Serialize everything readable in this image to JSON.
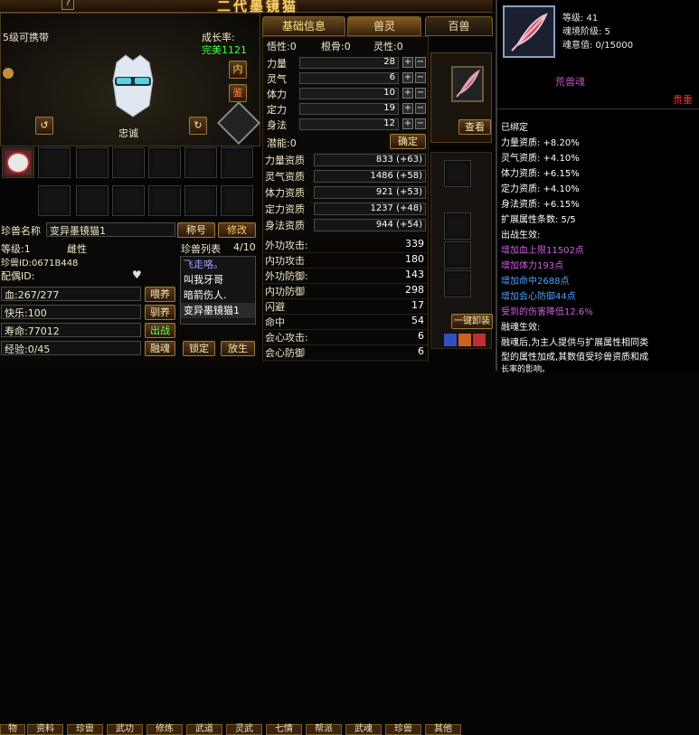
{
  "window": {
    "title": "二代墨镜猫"
  },
  "tabs": [
    {
      "label": "基础信息"
    },
    {
      "label": "兽灵"
    },
    {
      "label": "百兽"
    }
  ],
  "pet": {
    "level_carry": "5级可携带",
    "growth_label": "成长率:",
    "growth_value": "完美1121",
    "side_btn_1": "内",
    "side_btn_2": "鉴",
    "loyalty": "忠诚"
  },
  "attributes": {
    "wuxing_label": "悟性:0",
    "genggu_label": "根骨:0",
    "lingxing_label": "灵性:0",
    "stats": [
      {
        "label": "力量",
        "value": "28"
      },
      {
        "label": "灵气",
        "value": "6"
      },
      {
        "label": "体力",
        "value": "10"
      },
      {
        "label": "定力",
        "value": "19"
      },
      {
        "label": "身法",
        "value": "12"
      }
    ],
    "potential": "潜能:0",
    "confirm": "确定",
    "aptitudes": [
      {
        "label": "力量资质",
        "value": "833 (+63)"
      },
      {
        "label": "灵气资质",
        "value": "1486 (+58)"
      },
      {
        "label": "体力资质",
        "value": "921 (+53)"
      },
      {
        "label": "定力资质",
        "value": "1237 (+48)"
      },
      {
        "label": "身法资质",
        "value": "944 (+54)"
      }
    ],
    "combat": [
      {
        "label": "外功攻击:",
        "value": "339"
      },
      {
        "label": "内功攻击",
        "value": "180"
      },
      {
        "label": "外功防御:",
        "value": "143"
      },
      {
        "label": "内功防御",
        "value": "298"
      },
      {
        "label": "闪避",
        "value": "17"
      },
      {
        "label": "命中",
        "value": "54"
      },
      {
        "label": "会心攻击:",
        "value": "6"
      },
      {
        "label": "会心防御",
        "value": "6"
      }
    ]
  },
  "pet_info": {
    "name_label": "珍兽名称",
    "name_value": "变异墨镜猫1",
    "title_btn": "称号",
    "modify_btn": "修改",
    "level_label": "等级:1",
    "gender": "雌性",
    "pet_id": "珍兽ID:0671B448",
    "mate_id": "配偶ID:",
    "blood": "血:267/277",
    "happy": "快乐:100",
    "life": "寿命:77012",
    "exp": "经验:0/45",
    "feed_btn": "喂养",
    "tame_btn": "驯养",
    "battle_btn": "出战",
    "fuse_btn": "融魂",
    "lock_btn": "锁定",
    "release_btn": "放生",
    "list_label": "珍兽列表",
    "list_count": "4/10",
    "list_items": [
      "飞走咯。",
      "叫我牙哥",
      "暗箭伤人.",
      "变异墨镜猫1"
    ],
    "one_key_btn": "一键卸装",
    "view_btn": "查看"
  },
  "bottom_tabs": [
    "物",
    "资料",
    "珍兽",
    "武功",
    "修炼",
    "武道",
    "灵武",
    "七情",
    "帮派",
    "武魂",
    "珍兽",
    "其他"
  ],
  "soul_panel": {
    "level": "等级: 41",
    "realm": "魂境阶级: 5",
    "intent": "魂意值: 0/15000",
    "name": "荒兽魂",
    "quality": "贵重",
    "bound": "已绑定",
    "attrs": [
      "力量资质: +8.20%",
      "灵气资质: +4.10%",
      "体力资质: +6.15%",
      "定力资质: +4.10%",
      "身法资质: +6.15%"
    ],
    "ext_count": "扩展属性条数: 5/5",
    "battle_label": "出战生效:",
    "effects": [
      {
        "text": "增加血上限11502点",
        "color": "#d060e0"
      },
      {
        "text": "增加体力193点",
        "color": "#d060e0"
      },
      {
        "text": "增加命中2688点",
        "color": "#4aa0ff"
      },
      {
        "text": "增加会心防御44点",
        "color": "#4aa0ff"
      },
      {
        "text": "受到的伤害降低12.6%",
        "color": "#d060e0"
      }
    ],
    "fuse_label": "融魂生效:",
    "fuse_desc_1": "融魂后,为主人提供与扩展属性相同类",
    "fuse_desc_2": "型的属性加成,其数值受珍兽资质和成",
    "fuse_desc_3": "长率的影响。"
  },
  "colors": {
    "accent_gold": "#f0d890",
    "green": "#40ff40",
    "red_quality": "#ff3030",
    "soul_name": "#c050c0"
  }
}
